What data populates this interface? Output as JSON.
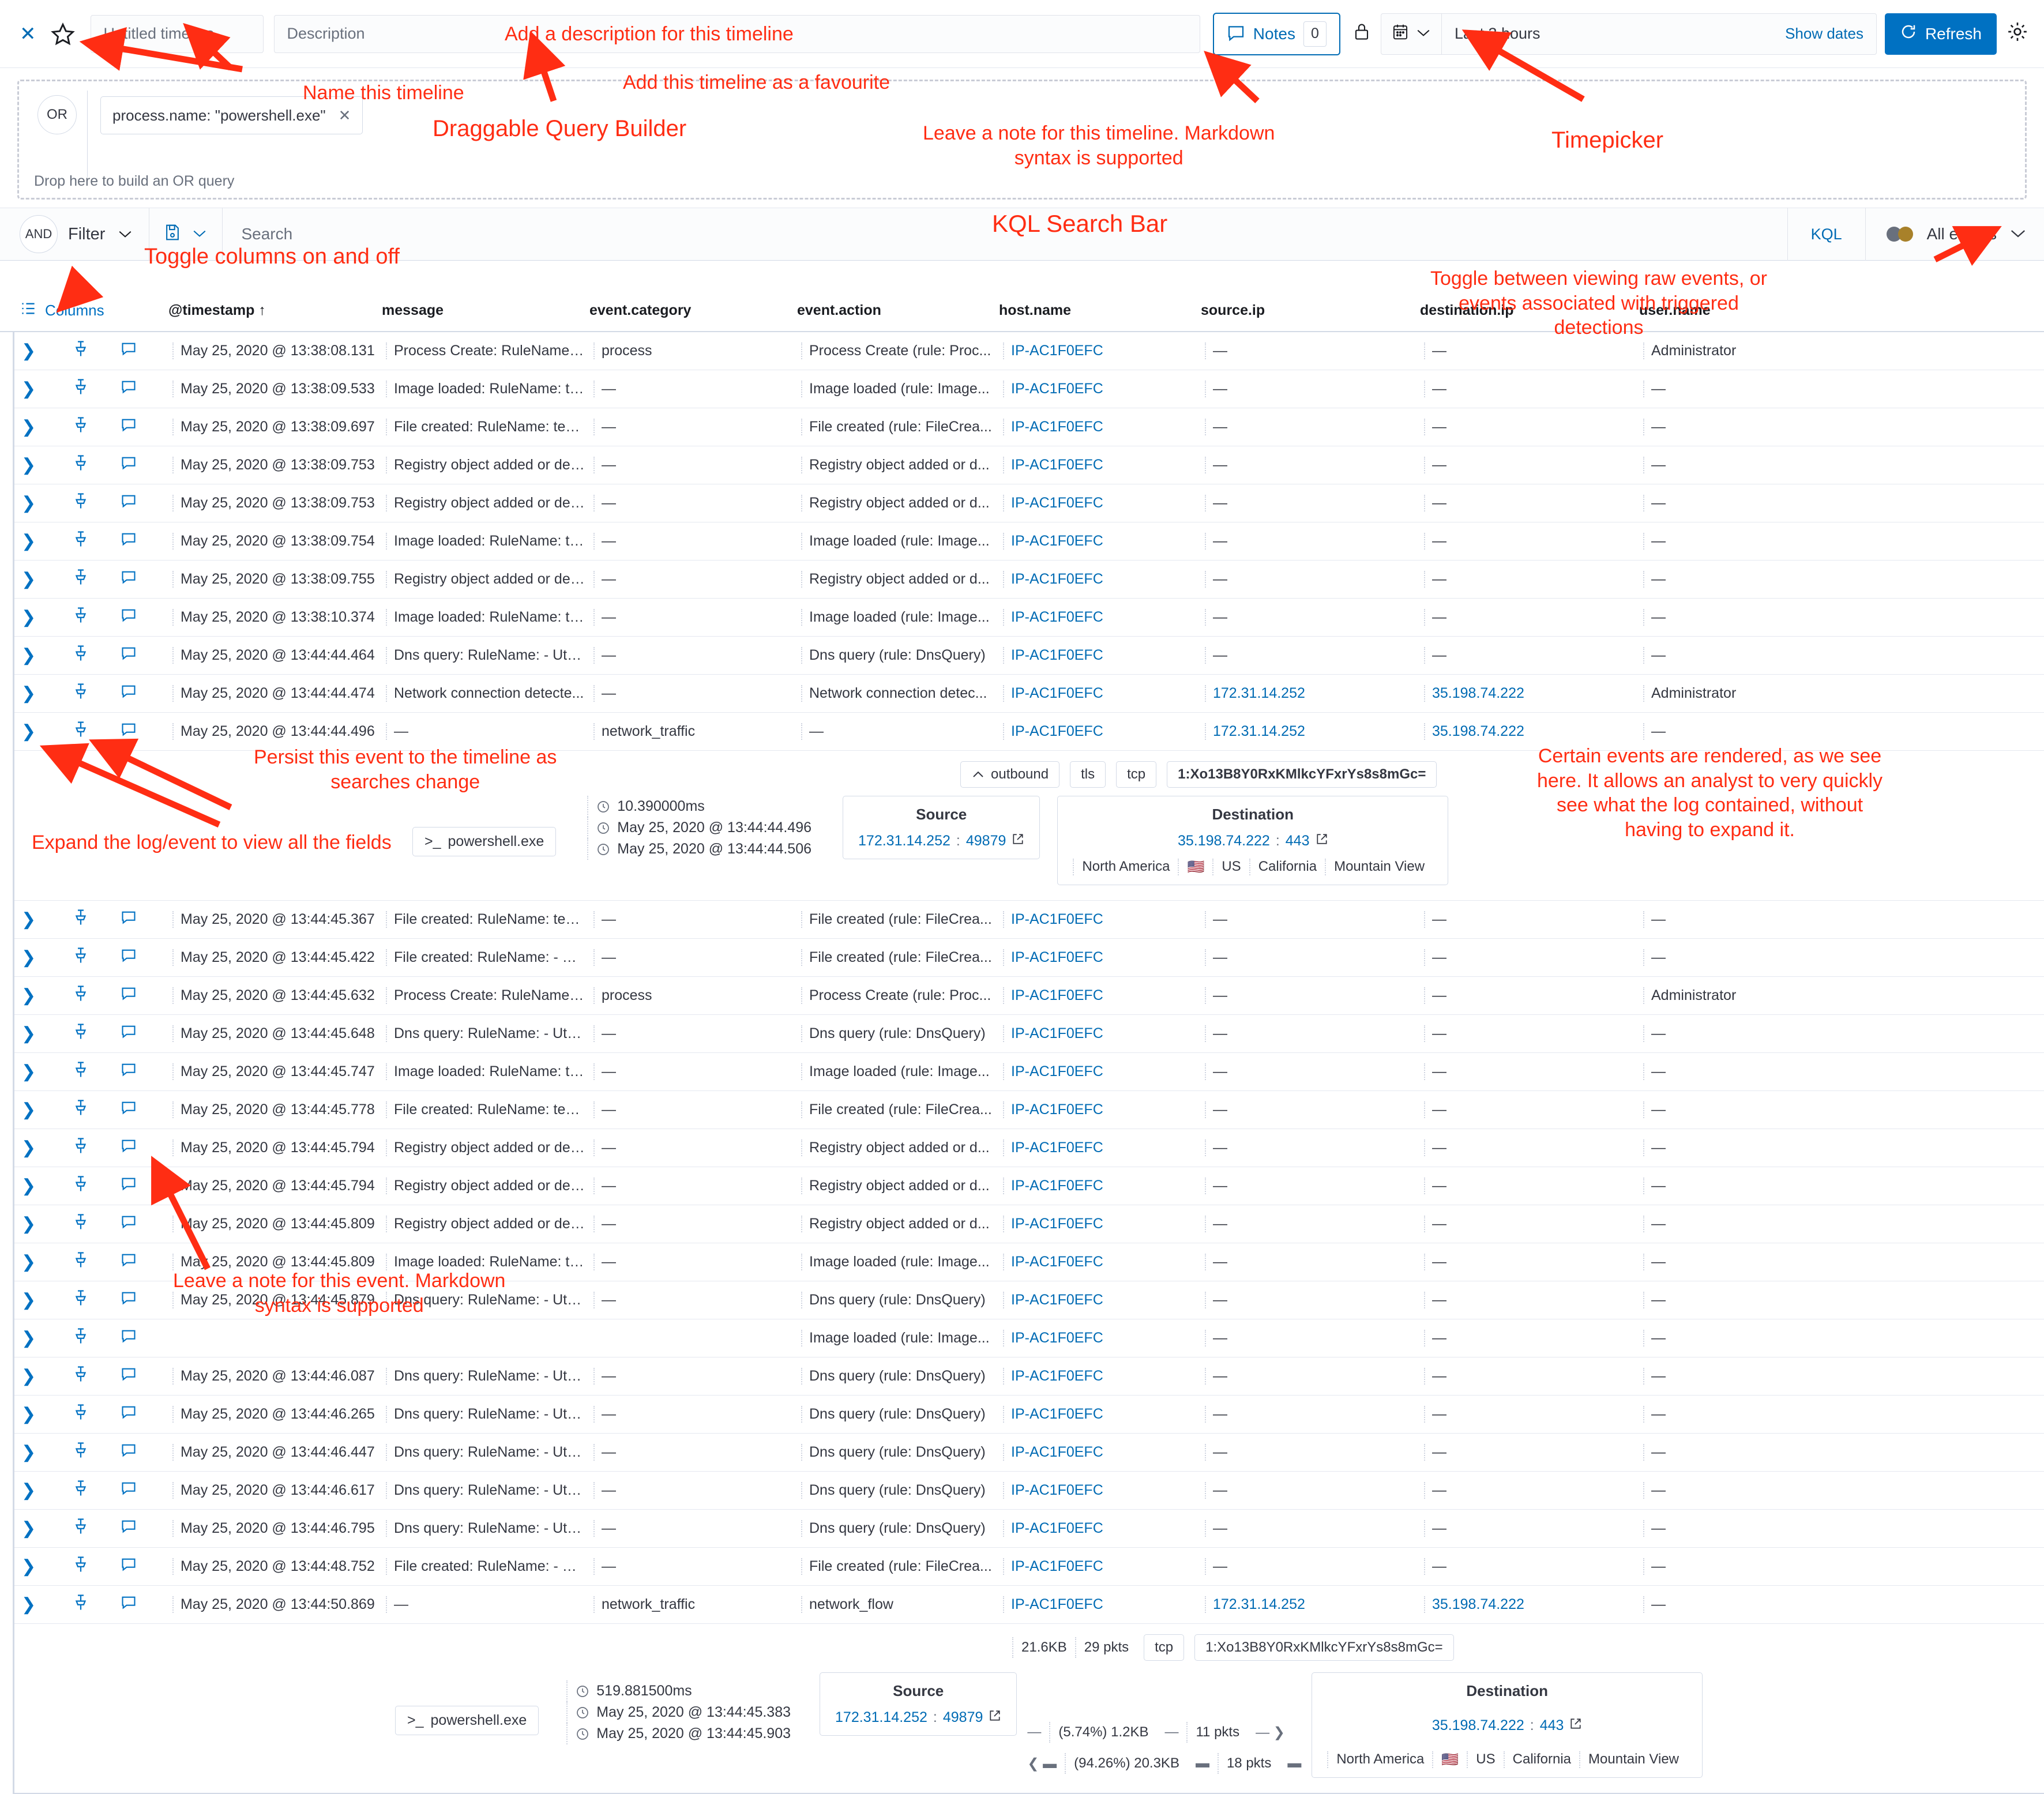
{
  "topbar": {
    "close_label": "✕",
    "timeline_title_placeholder": "Untitled timeline",
    "description_placeholder": "Description",
    "notes_label": "Notes",
    "notes_count": "0",
    "timepicker_value": "Last 3 hours",
    "show_dates_label": "Show dates",
    "refresh_label": "Refresh"
  },
  "query_builder": {
    "operator": "OR",
    "data_provider": "process.name: \"powershell.exe\"",
    "remove_label": "✕",
    "drop_hint": "Drop here to build an OR query"
  },
  "searchbar": {
    "operator": "AND",
    "filter_label": "Filter",
    "search_placeholder": "Search",
    "language_label": "KQL",
    "events_view_label": "All events"
  },
  "table": {
    "columns_button": "Columns",
    "headers": [
      "@timestamp ↑",
      "message",
      "event.category",
      "event.action",
      "host.name",
      "source.ip",
      "destination.ip",
      "user.name"
    ],
    "rows": [
      {
        "ts": "May 25, 2020 @ 13:38:08.131",
        "message": "Process Create: RuleName: t...",
        "category": "process",
        "action": "Process Create (rule: Proc...",
        "host": "IP-AC1F0EFC",
        "sip": "—",
        "dip": "—",
        "user": "Administrator"
      },
      {
        "ts": "May 25, 2020 @ 13:38:09.533",
        "message": "Image loaded: RuleName: te...",
        "category": "—",
        "action": "Image loaded (rule: Image...",
        "host": "IP-AC1F0EFC",
        "sip": "—",
        "dip": "—",
        "user": "—"
      },
      {
        "ts": "May 25, 2020 @ 13:38:09.697",
        "message": "File created: RuleName: tech...",
        "category": "—",
        "action": "File created (rule: FileCrea...",
        "host": "IP-AC1F0EFC",
        "sip": "—",
        "dip": "—",
        "user": "—"
      },
      {
        "ts": "May 25, 2020 @ 13:38:09.753",
        "message": "Registry object added or del...",
        "category": "—",
        "action": "Registry object added or d...",
        "host": "IP-AC1F0EFC",
        "sip": "—",
        "dip": "—",
        "user": "—"
      },
      {
        "ts": "May 25, 2020 @ 13:38:09.753",
        "message": "Registry object added or del...",
        "category": "—",
        "action": "Registry object added or d...",
        "host": "IP-AC1F0EFC",
        "sip": "—",
        "dip": "—",
        "user": "—"
      },
      {
        "ts": "May 25, 2020 @ 13:38:09.754",
        "message": "Image loaded: RuleName: te...",
        "category": "—",
        "action": "Image loaded (rule: Image...",
        "host": "IP-AC1F0EFC",
        "sip": "—",
        "dip": "—",
        "user": "—"
      },
      {
        "ts": "May 25, 2020 @ 13:38:09.755",
        "message": "Registry object added or del...",
        "category": "—",
        "action": "Registry object added or d...",
        "host": "IP-AC1F0EFC",
        "sip": "—",
        "dip": "—",
        "user": "—"
      },
      {
        "ts": "May 25, 2020 @ 13:38:10.374",
        "message": "Image loaded: RuleName: te...",
        "category": "—",
        "action": "Image loaded (rule: Image...",
        "host": "IP-AC1F0EFC",
        "sip": "—",
        "dip": "—",
        "user": "—"
      },
      {
        "ts": "May 25, 2020 @ 13:44:44.464",
        "message": "Dns query: RuleName: - Utc...",
        "category": "—",
        "action": "Dns query (rule: DnsQuery)",
        "host": "IP-AC1F0EFC",
        "sip": "—",
        "dip": "—",
        "user": "—"
      },
      {
        "ts": "May 25, 2020 @ 13:44:44.474",
        "message": "Network connection detecte...",
        "category": "—",
        "action": "Network connection detec...",
        "host": "IP-AC1F0EFC",
        "sip": "172.31.14.252",
        "dip": "35.198.74.222",
        "user": "Administrator"
      }
    ],
    "rows_lower": [
      {
        "ts": "May 25, 2020 @ 13:44:45.367",
        "message": "File created: RuleName: tech...",
        "category": "—",
        "action": "File created (rule: FileCrea...",
        "host": "IP-AC1F0EFC",
        "sip": "—",
        "dip": "—",
        "user": "—"
      },
      {
        "ts": "May 25, 2020 @ 13:44:45.422",
        "message": "File created: RuleName: - Ut...",
        "category": "—",
        "action": "File created (rule: FileCrea...",
        "host": "IP-AC1F0EFC",
        "sip": "—",
        "dip": "—",
        "user": "—"
      },
      {
        "ts": "May 25, 2020 @ 13:44:45.632",
        "message": "Process Create: RuleName: t...",
        "category": "process",
        "action": "Process Create (rule: Proc...",
        "host": "IP-AC1F0EFC",
        "sip": "—",
        "dip": "—",
        "user": "Administrator"
      },
      {
        "ts": "May 25, 2020 @ 13:44:45.648",
        "message": "Dns query: RuleName: - Utc...",
        "category": "—",
        "action": "Dns query (rule: DnsQuery)",
        "host": "IP-AC1F0EFC",
        "sip": "—",
        "dip": "—",
        "user": "—"
      },
      {
        "ts": "May 25, 2020 @ 13:44:45.747",
        "message": "Image loaded: RuleName: te...",
        "category": "—",
        "action": "Image loaded (rule: Image...",
        "host": "IP-AC1F0EFC",
        "sip": "—",
        "dip": "—",
        "user": "—"
      },
      {
        "ts": "May 25, 2020 @ 13:44:45.778",
        "message": "File created: RuleName: tech...",
        "category": "—",
        "action": "File created (rule: FileCrea...",
        "host": "IP-AC1F0EFC",
        "sip": "—",
        "dip": "—",
        "user": "—"
      },
      {
        "ts": "May 25, 2020 @ 13:44:45.794",
        "message": "Registry object added or del...",
        "category": "—",
        "action": "Registry object added or d...",
        "host": "IP-AC1F0EFC",
        "sip": "—",
        "dip": "—",
        "user": "—"
      },
      {
        "ts": "May 25, 2020 @ 13:44:45.794",
        "message": "Registry object added or del...",
        "category": "—",
        "action": "Registry object added or d...",
        "host": "IP-AC1F0EFC",
        "sip": "—",
        "dip": "—",
        "user": "—"
      },
      {
        "ts": "May 25, 2020 @ 13:44:45.809",
        "message": "Registry object added or del...",
        "category": "—",
        "action": "Registry object added or d...",
        "host": "IP-AC1F0EFC",
        "sip": "—",
        "dip": "—",
        "user": "—"
      },
      {
        "ts": "May 25, 2020 @ 13:44:45.809",
        "message": "Image loaded: RuleName: te...",
        "category": "—",
        "action": "Image loaded (rule: Image...",
        "host": "IP-AC1F0EFC",
        "sip": "—",
        "dip": "—",
        "user": "—"
      },
      {
        "ts": "May 25, 2020 @ 13:44:45.879",
        "message": "Dns query: RuleName: - Utc...",
        "category": "—",
        "action": "Dns query (rule: DnsQuery)",
        "host": "IP-AC1F0EFC",
        "sip": "—",
        "dip": "—",
        "user": "—"
      },
      {
        "ts": "",
        "message": "",
        "category": "",
        "action": "Image loaded (rule: Image...",
        "host": "IP-AC1F0EFC",
        "sip": "—",
        "dip": "—",
        "user": "—"
      },
      {
        "ts": "May 25, 2020 @ 13:44:46.087",
        "message": "Dns query: RuleName: - Utc...",
        "category": "—",
        "action": "Dns query (rule: DnsQuery)",
        "host": "IP-AC1F0EFC",
        "sip": "—",
        "dip": "—",
        "user": "—"
      },
      {
        "ts": "May 25, 2020 @ 13:44:46.265",
        "message": "Dns query: RuleName: - Utc...",
        "category": "—",
        "action": "Dns query (rule: DnsQuery)",
        "host": "IP-AC1F0EFC",
        "sip": "—",
        "dip": "—",
        "user": "—"
      },
      {
        "ts": "May 25, 2020 @ 13:44:46.447",
        "message": "Dns query: RuleName: - Utc...",
        "category": "—",
        "action": "Dns query (rule: DnsQuery)",
        "host": "IP-AC1F0EFC",
        "sip": "—",
        "dip": "—",
        "user": "—"
      },
      {
        "ts": "May 25, 2020 @ 13:44:46.617",
        "message": "Dns query: RuleName: - Utc...",
        "category": "—",
        "action": "Dns query (rule: DnsQuery)",
        "host": "IP-AC1F0EFC",
        "sip": "—",
        "dip": "—",
        "user": "—"
      },
      {
        "ts": "May 25, 2020 @ 13:44:46.795",
        "message": "Dns query: RuleName: - Utc...",
        "category": "—",
        "action": "Dns query (rule: DnsQuery)",
        "host": "IP-AC1F0EFC",
        "sip": "—",
        "dip": "—",
        "user": "—"
      },
      {
        "ts": "May 25, 2020 @ 13:44:48.752",
        "message": "File created: RuleName: - Ut...",
        "category": "—",
        "action": "File created (rule: FileCrea...",
        "host": "IP-AC1F0EFC",
        "sip": "—",
        "dip": "—",
        "user": "—"
      }
    ],
    "network_row_1": {
      "ts": "May 25, 2020 @ 13:44:44.496",
      "message": "—",
      "category": "network_traffic",
      "action": "—",
      "host": "IP-AC1F0EFC",
      "sip": "172.31.14.252",
      "dip": "35.198.74.222",
      "user": "—"
    },
    "network_row_2": {
      "ts": "May 25, 2020 @ 13:44:50.869",
      "message": "—",
      "category": "network_traffic",
      "action": "network_flow",
      "host": "IP-AC1F0EFC",
      "sip": "172.31.14.252",
      "dip": "35.198.74.222",
      "user": "—"
    }
  },
  "event_detail_1": {
    "process": "powershell.exe",
    "duration": "10.390000ms",
    "start_time": "May 25, 2020 @ 13:44:44.496",
    "end_time": "May 25, 2020 @ 13:44:44.506",
    "direction": "outbound",
    "tls": "tls",
    "transport": "tcp",
    "community_id": "1:Xo13B8Y0RxKMlkcYFxrYs8s8mGc=",
    "source_title": "Source",
    "source_ip": "172.31.14.252",
    "source_port": "49879",
    "destination_title": "Destination",
    "destination_ip": "35.198.74.222",
    "destination_port": "443",
    "geo": [
      "North America",
      "US",
      "California",
      "Mountain View"
    ]
  },
  "event_detail_2": {
    "process": "powershell.exe",
    "duration": "519.881500ms",
    "start_time": "May 25, 2020 @ 13:44:45.383",
    "end_time": "May 25, 2020 @ 13:44:45.903",
    "bytes": "21.6KB",
    "packets": "29 pkts",
    "transport": "tcp",
    "community_id": "1:Xo13B8Y0RxKMlkcYFxrYs8s8mGc=",
    "source_title": "Source",
    "source_ip": "172.31.14.252",
    "source_port": "49879",
    "destination_title": "Destination",
    "destination_ip": "35.198.74.222",
    "destination_port": "443",
    "out_pct": "(5.74%) 1.2KB",
    "out_pkts": "11 pkts",
    "in_pct": "(94.26%) 20.3KB",
    "in_pkts": "18 pkts",
    "geo": [
      "North America",
      "US",
      "California",
      "Mountain View"
    ]
  },
  "annotations": {
    "a1": "Add a description for this timeline",
    "a2": "Name this timeline",
    "a3": "Add this timeline as a favourite",
    "a4": "Draggable Query Builder",
    "a5": "Leave a note for this timeline. Markdown\nsyntax is supported",
    "a6": "Timepicker",
    "a7": "KQL Search Bar",
    "a8": "Toggle columns on and off",
    "a9": "Toggle between viewing raw events, or\nevents associated with triggered\ndetections",
    "a10": "Persist this event to the timeline as\nsearches change",
    "a11": "Expand the log/event to view all the fields",
    "a12": "Certain events are rendered, as we see\nhere. It allows an analyst to very quickly\nsee what the log contained, without\nhaving to expand it.",
    "a13": "Leave a note for this event. Markdown\nsyntax is supported"
  },
  "colors": {
    "accent": "#006BB4",
    "annotation": "#FF2D13",
    "refresh": "#0071c2"
  }
}
